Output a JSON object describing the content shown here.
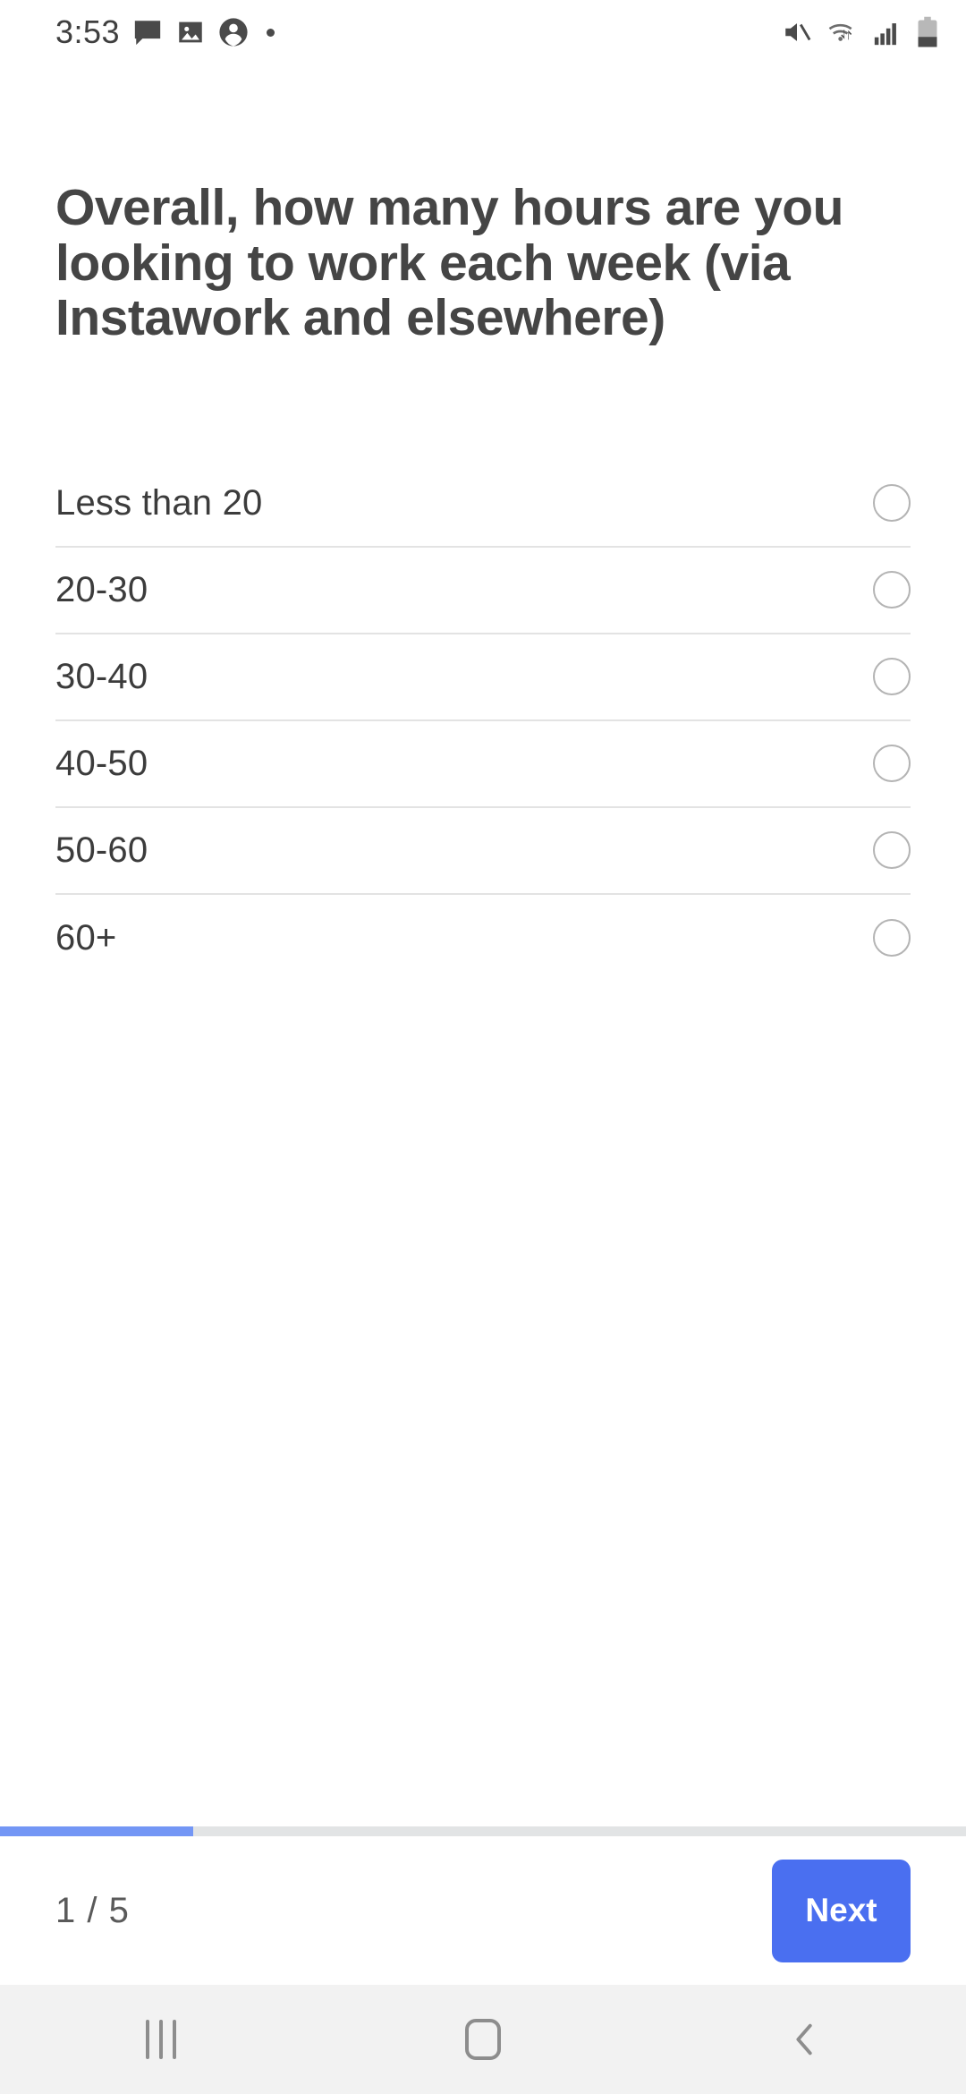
{
  "status_bar": {
    "time": "3:53",
    "left_icons": [
      "message-icon",
      "image-icon",
      "account-circle-icon",
      "dot-indicator"
    ],
    "right_icons": [
      "mute-icon",
      "wifi-icon",
      "cellular-signal-icon",
      "battery-icon"
    ],
    "battery_level_percent": 37
  },
  "survey": {
    "question": "Overall, how many hours are you looking to work each week (via Instawork and elsewhere)",
    "options": [
      {
        "label": "Less than 20",
        "selected": false
      },
      {
        "label": "20-30",
        "selected": false
      },
      {
        "label": "30-40",
        "selected": false
      },
      {
        "label": "40-50",
        "selected": false
      },
      {
        "label": "50-60",
        "selected": false
      },
      {
        "label": "60+",
        "selected": false
      }
    ]
  },
  "footer": {
    "page_counter": "1 / 5",
    "next_label": "Next",
    "progress_percent": 20,
    "accent_color": "#4a6ff0",
    "progress_fill_color": "#7396f5",
    "progress_track_color": "#e2e4e5"
  },
  "nav_bar": {
    "recents_label": "recents-icon",
    "home_label": "home-icon",
    "back_label": "back-icon"
  }
}
